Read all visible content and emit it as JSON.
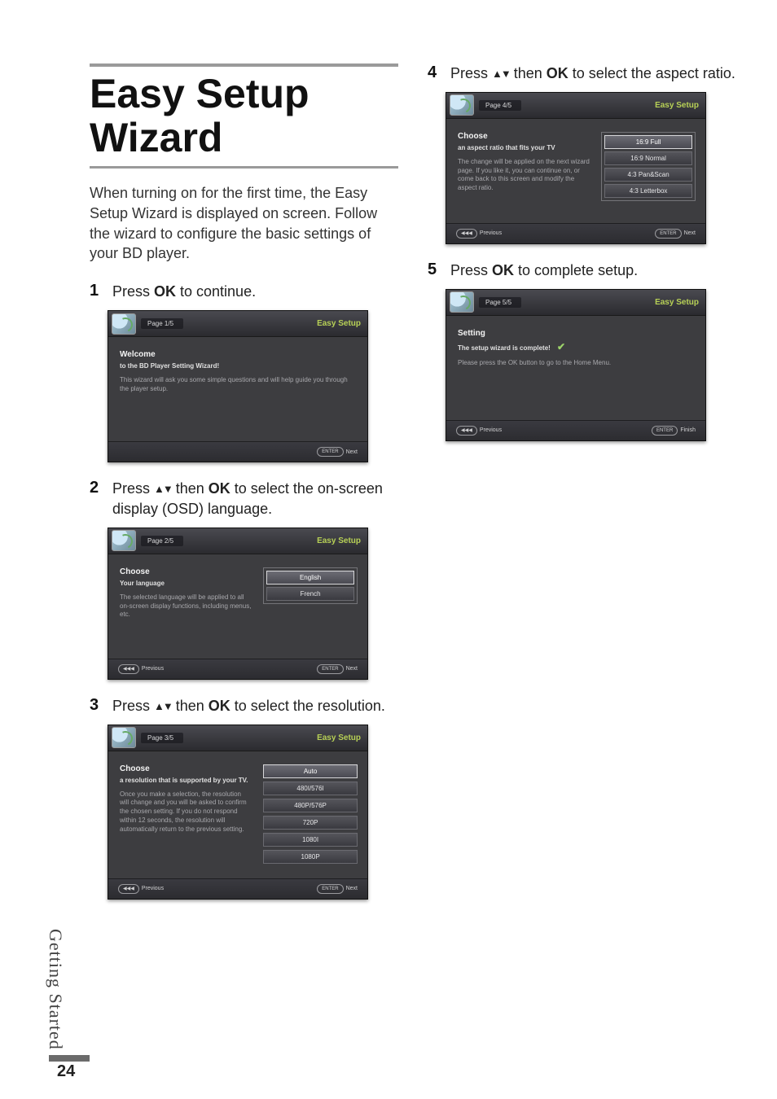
{
  "sideLabel": "Getting Started",
  "pageNumber": "24",
  "title": "Easy Setup Wizard",
  "intro": "When turning on for the first time, the Easy Setup Wizard is displayed on screen. Follow the wizard to configure the basic settings of your BD player.",
  "brand": "Easy Setup",
  "footer": {
    "prevPill": "◀◀◀",
    "prevLabel": "Previous",
    "nextPill": "ENTER",
    "nextLabel": "Next",
    "finishLabel": "Finish"
  },
  "steps": {
    "s1": {
      "num": "1",
      "pre": "Press ",
      "ok": "OK",
      "post": " to continue.",
      "panel": {
        "page": "Page  1/5",
        "title": "Welcome",
        "sub": "to the BD Player Setting Wizard!",
        "desc": "This wizard will ask you some simple questions and will help guide you through the player setup."
      }
    },
    "s2": {
      "num": "2",
      "pre": "Press ",
      "arrows": "▲▼",
      "mid": " then ",
      "ok": "OK",
      "post": " to select the on-screen display (OSD) language.",
      "panel": {
        "page": "Page  2/5",
        "title": "Choose",
        "sub": "Your language",
        "desc": "The selected language will be applied to all on-screen display functions, including menus, etc.",
        "options": [
          "English",
          "French"
        ]
      }
    },
    "s3": {
      "num": "3",
      "pre": "Press ",
      "arrows": "▲▼",
      "mid": " then ",
      "ok": "OK",
      "post": " to select the resolution.",
      "panel": {
        "page": "Page  3/5",
        "title": "Choose",
        "sub": "a resolution that is supported by your TV.",
        "desc": "Once you make a selection, the resolution will change and you will be asked to confirm the chosen setting. If you do not respond within 12 seconds, the resolution will automatically return to the previous setting.",
        "options": [
          "Auto",
          "480I/576I",
          "480P/576P",
          "720P",
          "1080I",
          "1080P"
        ]
      }
    },
    "s4": {
      "num": "4",
      "pre": "Press ",
      "arrows": "▲▼",
      "mid": " then ",
      "ok": "OK",
      "post": " to select the aspect ratio.",
      "panel": {
        "page": "Page  4/5",
        "title": "Choose",
        "sub": "an aspect ratio that fits your TV",
        "desc": "The change will be applied on the next wizard page. If you like it, you can continue on, or come back to this screen and modify the aspect ratio.",
        "options": [
          "16:9 Full",
          "16:9 Normal",
          "4:3 Pan&Scan",
          "4:3 Letterbox"
        ]
      }
    },
    "s5": {
      "num": "5",
      "pre": "Press ",
      "ok": "OK",
      "post": " to complete setup.",
      "panel": {
        "page": "Page  5/5",
        "title": "Setting",
        "sub": "The setup wizard is complete!",
        "desc": "Please press the OK button to go to the Home Menu."
      }
    }
  }
}
